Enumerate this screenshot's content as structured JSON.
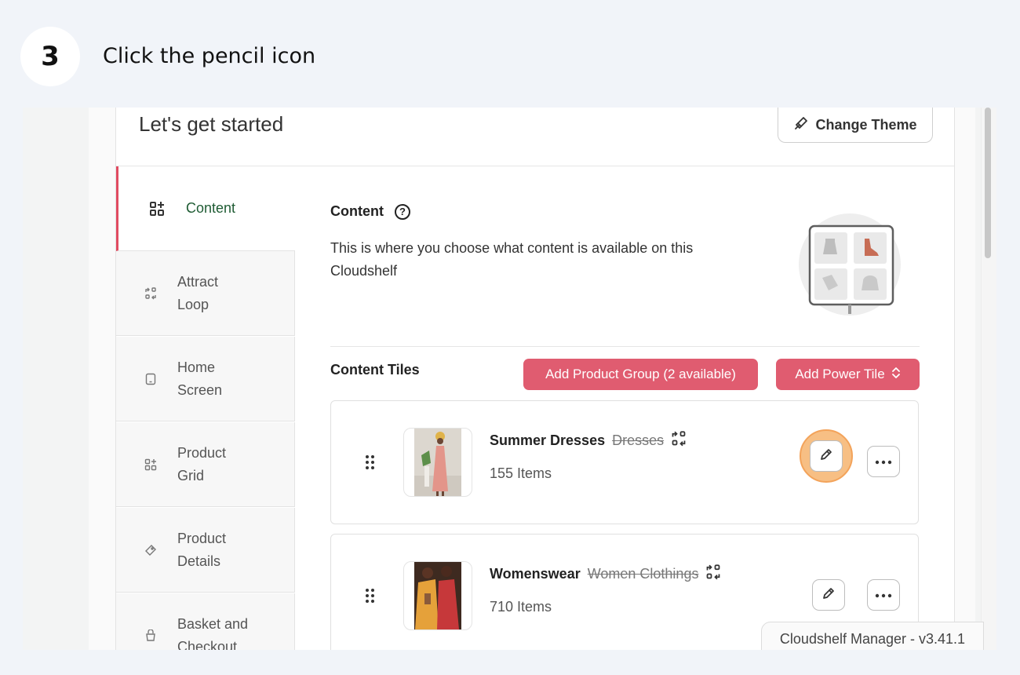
{
  "step": {
    "number": "3",
    "instruction": "Click the pencil icon"
  },
  "header": {
    "title": "Let's get started",
    "change_theme_label": "Change Theme"
  },
  "nav": {
    "items": [
      {
        "line1": "Content",
        "line2": ""
      },
      {
        "line1": "Attract",
        "line2": "Loop"
      },
      {
        "line1": "Home",
        "line2": "Screen"
      },
      {
        "line1": "Product",
        "line2": "Grid"
      },
      {
        "line1": "Product",
        "line2": "Details"
      },
      {
        "line1": "Basket and",
        "line2": "Checkout"
      }
    ]
  },
  "content": {
    "title": "Content",
    "help_glyph": "?",
    "description": "This is where you choose what content is available on this Cloudshelf"
  },
  "tiles": {
    "title": "Content Tiles",
    "add_group_label": "Add Product Group (2 available)",
    "add_power_label": "Add Power Tile",
    "items": [
      {
        "name": "Summer Dresses",
        "original": "Dresses",
        "count": "155 Items"
      },
      {
        "name": "Womenswear",
        "original": "Women Clothings",
        "count": "710 Items"
      }
    ]
  },
  "footer": {
    "version": "Cloudshelf Manager - v3.41.1"
  },
  "colors": {
    "accent": "#e05c70",
    "active_text": "#1f5c34",
    "highlight": "#f6b46e"
  }
}
